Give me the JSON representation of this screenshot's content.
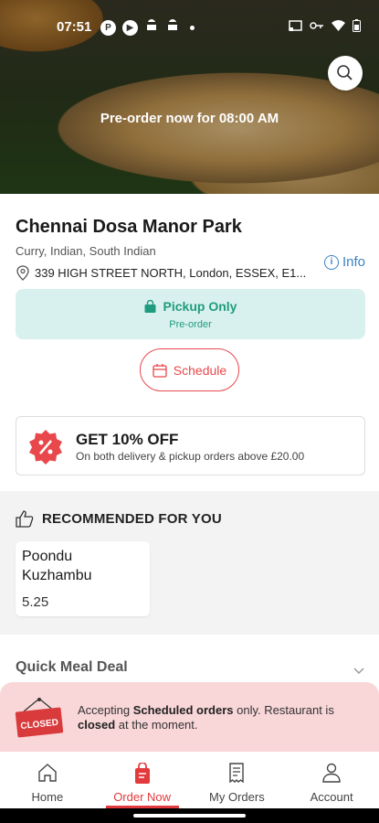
{
  "status_bar": {
    "time": "07:51"
  },
  "hero": {
    "preorder_text": "Pre-order now for 08:00 AM"
  },
  "restaurant": {
    "name": "Chennai Dosa Manor Park",
    "cuisine": "Curry, Indian, South Indian",
    "address": "339 HIGH STREET NORTH, London, ESSEX, E1...",
    "info_label": "Info"
  },
  "pickup": {
    "title": "Pickup Only",
    "subtitle": "Pre-order"
  },
  "schedule_label": "Schedule",
  "offer": {
    "title": "GET 10% OFF",
    "subtitle": "On both delivery & pickup orders above £20.00"
  },
  "recommended": {
    "header": "RECOMMENDED FOR YOU",
    "items": [
      {
        "name": "Poondu Kuzhambu",
        "price": "5.25"
      }
    ]
  },
  "deal_section": {
    "title": "Quick Meal Deal"
  },
  "closed_banner": {
    "sign_text": "CLOSED",
    "p1": "Accepting ",
    "b1": "Scheduled orders",
    "p2": " only. Restaurant is ",
    "b2": "closed",
    "p3": " at the moment."
  },
  "nav": {
    "items": [
      {
        "label": "Home",
        "icon": "home-icon"
      },
      {
        "label": "Order Now",
        "icon": "order-bag-icon"
      },
      {
        "label": "My Orders",
        "icon": "receipt-icon"
      },
      {
        "label": "Account",
        "icon": "person-icon"
      }
    ],
    "active_index": 1
  },
  "colors": {
    "accent": "#e33a3d",
    "pickup_bg": "#d9f1ee",
    "pickup_text": "#1f9c7e",
    "banner_bg": "#f9d6d8",
    "link": "#3b82c4"
  }
}
